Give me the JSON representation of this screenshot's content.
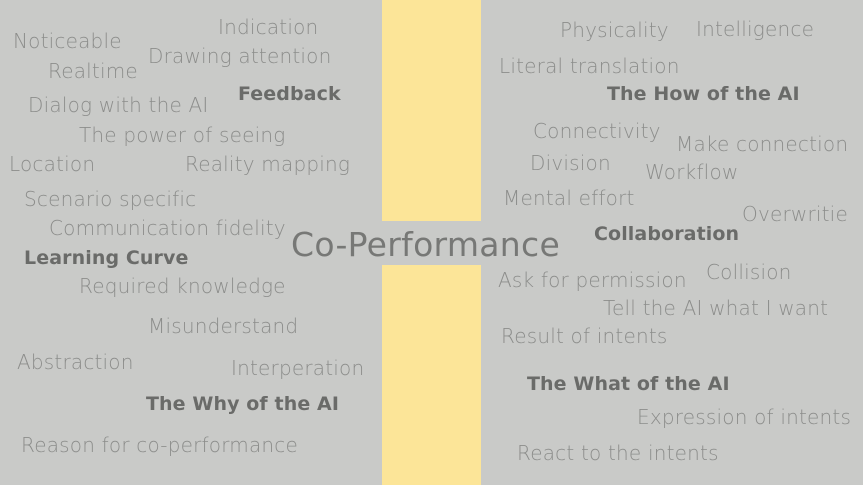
{
  "center_title": "Co-Performance",
  "left": {
    "noticeable": "Noticeable",
    "indication": "Indication",
    "drawing_attention": "Drawing attention",
    "realtime": "Realtime",
    "feedback": "Feedback",
    "dialog": "Dialog with the AI",
    "power_of_seeing": "The power of seeing",
    "location": "Location",
    "reality_mapping": "Reality mapping",
    "scenario_specific": "Scenario specific",
    "communication_fidelity": "Communication fidelity",
    "learning_curve": "Learning Curve",
    "required_knowledge": "Required knowledge",
    "misunderstand": "Misunderstand",
    "abstraction": "Abstraction",
    "interperation": "Interperation",
    "why_of_ai": "The Why of the AI",
    "reason": "Reason for co-performance"
  },
  "right": {
    "physicality": "Physicality",
    "intelligence": "Intelligence",
    "literal_translation": "Literal translation",
    "how_of_ai": "The How of the AI",
    "connectivity": "Connectivity",
    "make_connection": "Make connection",
    "division": "Division",
    "workflow": "Workflow",
    "mental_effort": "Mental effort",
    "overwritie": "Overwritie",
    "collaboration": "Collaboration",
    "ask_permission": "Ask for permission",
    "collision": "Collision",
    "tell_ai": "Tell the AI what I want",
    "result_of_intents": "Result of intents",
    "what_of_ai": "The What of the AI",
    "expression_of_intents": "Expression of intents",
    "react_to_intents": "React to the intents"
  }
}
